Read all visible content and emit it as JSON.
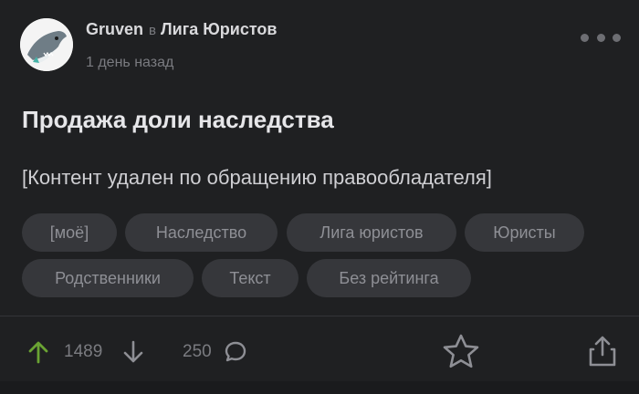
{
  "post": {
    "author": "Gruven",
    "in_word": "в",
    "community": "Лига Юристов",
    "time": "1 день назад",
    "title": "Продажа доли наследства",
    "content": "[Контент удален по обращению правообладателя]",
    "tags": [
      "[моё]",
      "Наследство",
      "Лига юристов",
      "Юристы",
      "Родственники",
      "Текст",
      "Без рейтинга"
    ]
  },
  "actions": {
    "rating": "1489",
    "comments": "250"
  },
  "colors": {
    "background": "#1f2022",
    "tag_background": "#36373b",
    "upvote_green": "#6aa333",
    "muted_text": "#7a7b80"
  },
  "icons": [
    "shark-avatar",
    "more-dots-icon",
    "arrow-up-icon",
    "arrow-down-icon",
    "comment-icon",
    "star-icon",
    "share-icon"
  ]
}
